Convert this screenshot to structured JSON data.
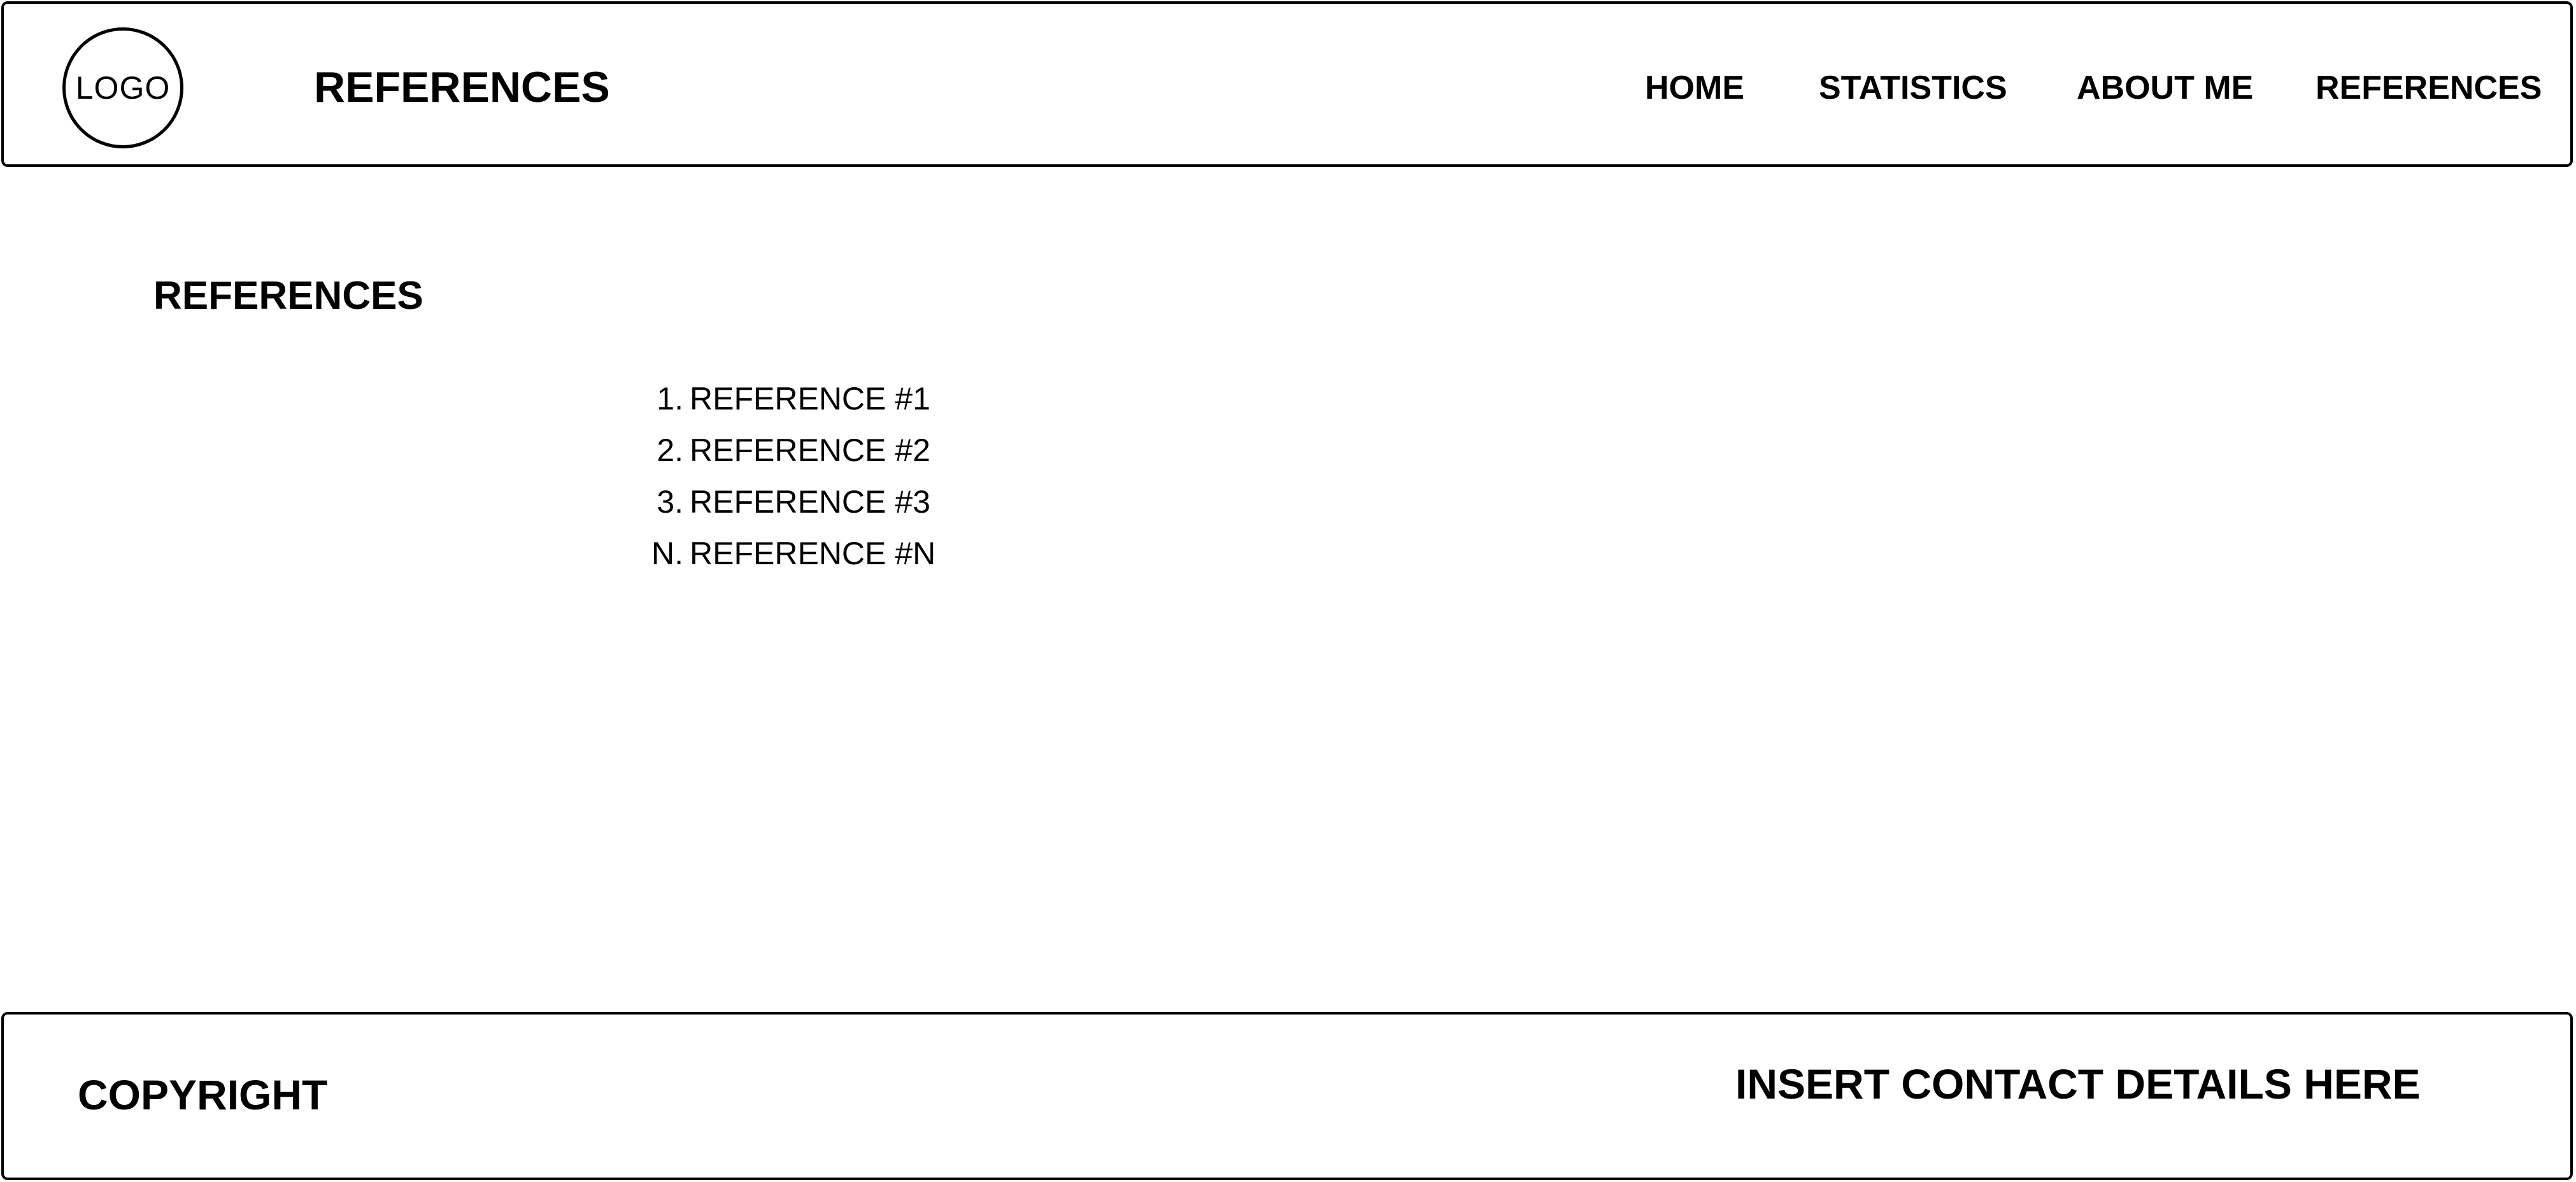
{
  "header": {
    "logo_text": "LOGO",
    "title": "REFERENCES",
    "nav": [
      {
        "label": "HOME"
      },
      {
        "label": "STATISTICS"
      },
      {
        "label": "ABOUT ME"
      },
      {
        "label": "REFERENCES"
      }
    ]
  },
  "main": {
    "section_title": "REFERENCES",
    "references": [
      {
        "marker": "1.",
        "text": "REFERENCE #1"
      },
      {
        "marker": "2.",
        "text": "REFERENCE #2"
      },
      {
        "marker": "3.",
        "text": "REFERENCE #3"
      },
      {
        "marker": "N.",
        "text": "REFERENCE #N"
      }
    ]
  },
  "footer": {
    "copyright": "COPYRIGHT",
    "contact": "INSERT CONTACT DETAILS HERE"
  }
}
